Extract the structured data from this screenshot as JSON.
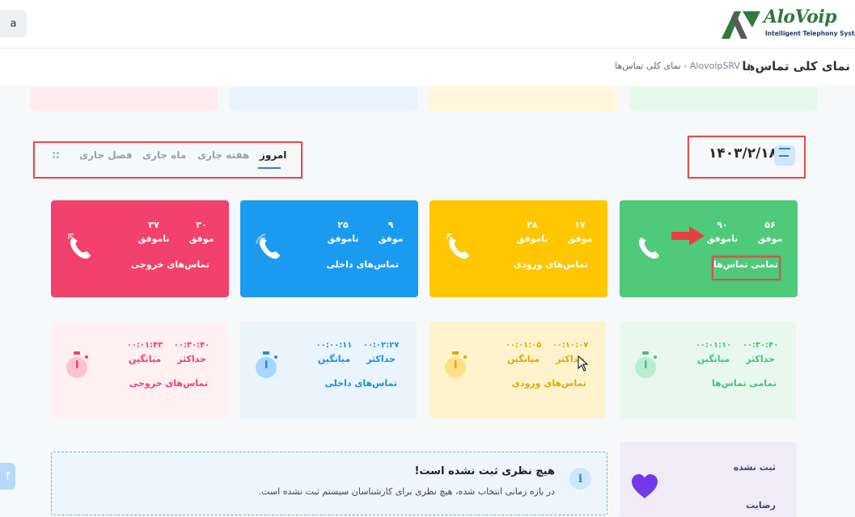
{
  "header": {
    "user_initial": "a",
    "logo_name": "AloVoip",
    "logo_tagline": "Intelligent Telephony System"
  },
  "breadcrumb": {
    "title": "نمای کلی تماس‌ها",
    "items": [
      "AlovoipSRV",
      "-",
      "نمای کلی تماس‌ها"
    ]
  },
  "date": {
    "value": "۱۴۰۳/۲/۱۸",
    "icon": "calendar-icon"
  },
  "tabs": [
    {
      "label": "امروز",
      "active": true
    },
    {
      "label": "هفته جاری",
      "active": false
    },
    {
      "label": "ماه جاری",
      "active": false
    },
    {
      "label": "فصل جاری",
      "active": false
    }
  ],
  "stats": [
    {
      "title": "تمامی تماس‌ها",
      "success": "۵۶",
      "fail": "۹۰",
      "success_label": "موفق",
      "fail_label": "ناموفق",
      "color": "#4fc97a",
      "icon": "phone-icon"
    },
    {
      "title": "تماس‌های ورودی",
      "success": "۱۷",
      "fail": "۲۸",
      "success_label": "موفق",
      "fail_label": "ناموفق",
      "color": "#ffc107",
      "icon": "phone-incoming-icon"
    },
    {
      "title": "تماس‌های داخلی",
      "success": "۹",
      "fail": "۲۵",
      "success_label": "موفق",
      "fail_label": "ناموفق",
      "color": "#1a9bf0",
      "icon": "phone-internal-icon"
    },
    {
      "title": "تماس‌های خروجی",
      "success": "۳۰",
      "fail": "۳۷",
      "success_label": "موفق",
      "fail_label": "ناموفق",
      "color": "#f1416c",
      "icon": "phone-outgoing-icon"
    }
  ],
  "averages": [
    {
      "title": "تمامی تماس‌ها",
      "max": "۰۰:۳۰:۴۰",
      "avg": "۰۰:۰۱:۱۰",
      "max_label": "حداکثر",
      "avg_label": "میانگین",
      "color": "#43c27a",
      "bg": "#e8f8ee",
      "icon": "stopwatch-icon"
    },
    {
      "title": "تماس‌های ورودی",
      "max": "۰۰:۱۰:۰۷",
      "avg": "۰۰:۰۱:۰۵",
      "max_label": "حداکثر",
      "avg_label": "میانگین",
      "color": "#e0a800",
      "bg": "#fff6d6",
      "icon": "stopwatch-icon"
    },
    {
      "title": "تماس‌های داخلی",
      "max": "۰۰:۰۲:۲۷",
      "avg": "۰۰:۰۰:۱۱",
      "max_label": "حداکثر",
      "avg_label": "میانگین",
      "color": "#1b8fe0",
      "bg": "#e9f4fd",
      "icon": "stopwatch-icon"
    },
    {
      "title": "تماس‌های خروجی",
      "max": "۰۰:۳۰:۴۰",
      "avg": "۰۰:۰۱:۴۳",
      "max_label": "حداکثر",
      "avg_label": "میانگین",
      "color": "#f1416c",
      "bg": "#fff0f3",
      "icon": "stopwatch-icon"
    }
  ],
  "feedback": {
    "title": "هیچ نظری ثبت نشده است!",
    "message": "در بازه زمانی انتخاب شده، هیچ نظری برای کارشناسان سیستم ثبت نشده است.",
    "icon": "info-icon"
  },
  "satisfaction": {
    "status": "ثبت نشده",
    "label": "رضایت",
    "icon": "heart-icon",
    "color": "#7239ea"
  }
}
